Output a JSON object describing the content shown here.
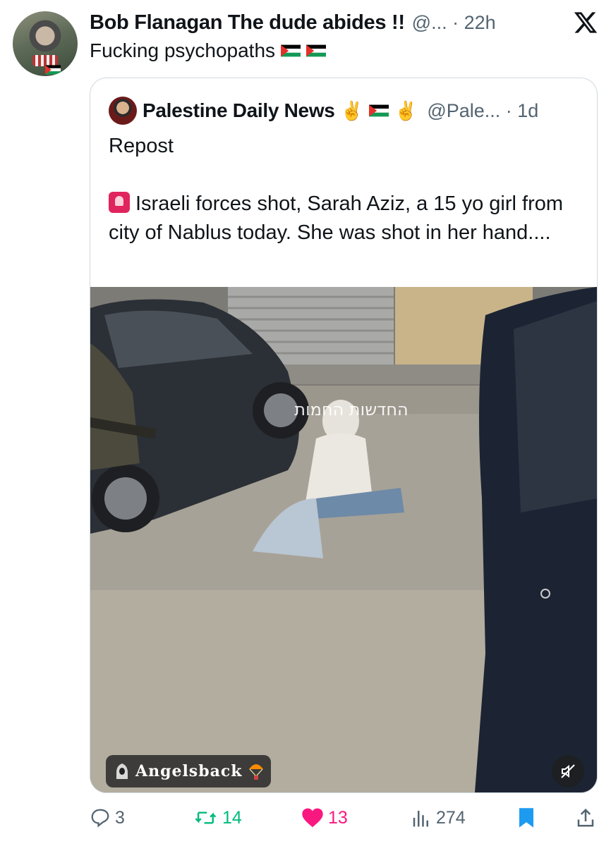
{
  "tweet": {
    "author_name": "Bob Flanagan The dude abides !!",
    "handle_time": "@... · 22h",
    "text": "Fucking psychopaths",
    "flag_emoji_count": 2
  },
  "quoted": {
    "author_name": "Palestine Daily News",
    "emojis": [
      "✌️",
      "✌️"
    ],
    "handle_time": "@Pale... · 1d",
    "line1": "Repost",
    "line2": "Israeli forces shot, Sarah Aziz, a 15 yo girl from city of Nablus today. She was shot in her hand....",
    "video_overlay_text": "החדשות החמות",
    "watermark": "Angelsback"
  },
  "actions": {
    "replies": "3",
    "reposts": "14",
    "likes": "13",
    "views": "274"
  },
  "colors": {
    "text": "#0f1419",
    "secondary": "#536471",
    "repost_green": "#00ba7c",
    "like_pink": "#f91880",
    "accent_blue": "#1d9bf0",
    "border": "#cfd9de"
  }
}
